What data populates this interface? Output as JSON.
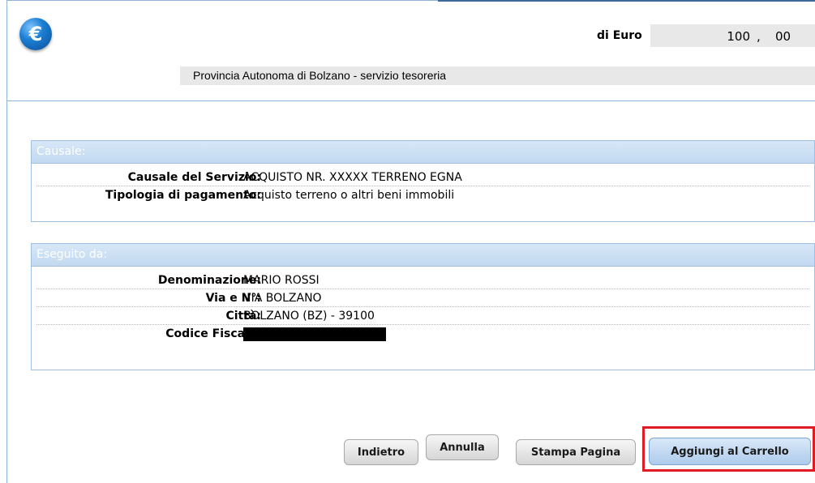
{
  "header": {
    "euro_icon_symbol": "€",
    "amount_label": "di Euro",
    "amount_integer": "100",
    "amount_separator": ",",
    "amount_decimal": "00",
    "beneficiary": "Provincia Autonoma di Bolzano - servizio tesoreria"
  },
  "causale": {
    "title": "Causale:",
    "rows": [
      {
        "label": "Causale del Servizio:",
        "value": "ACQUISTO NR. XXXXX TERRENO EGNA"
      },
      {
        "label": "Tipologia di pagamento:",
        "value": "Acquisto terreno o altri beni immobili"
      }
    ]
  },
  "eseguito": {
    "title": "Eseguito da:",
    "rows": [
      {
        "label": "Denominazione:",
        "value": "MARIO ROSSI"
      },
      {
        "label": "Via e N°:",
        "value": "VIA BOLZANO"
      },
      {
        "label": "Città:",
        "value": "BOLZANO (BZ) - 39100"
      },
      {
        "label": "Codice Fiscale:",
        "value": ""
      }
    ]
  },
  "buttons": {
    "indietro": "Indietro",
    "annulla": "Annulla",
    "stampa": "Stampa Pagina",
    "aggiungi": "Aggiungi al Carrello"
  },
  "colors": {
    "accent_blue": "#1c7fd4",
    "section_header": "#c2d9f0",
    "highlight_red": "#e01b24"
  }
}
